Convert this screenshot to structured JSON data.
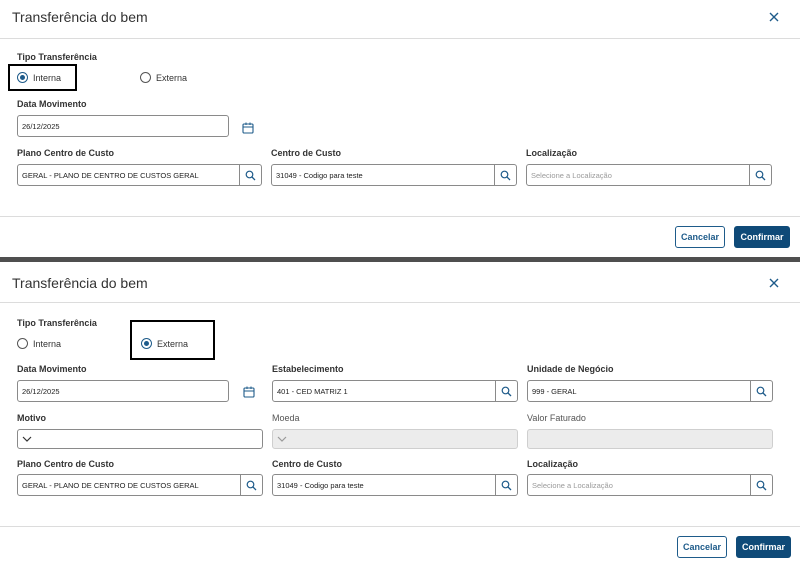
{
  "panel1": {
    "title": "Transferência do bem",
    "tipo_label": "Tipo Transferência",
    "radio_interna": "Interna",
    "radio_externa": "Externa",
    "data_movimento_label": "Data Movimento",
    "data_movimento_value": "26/12/2025",
    "plano_label": "Plano Centro de Custo",
    "plano_value": "GERAL - PLANO DE CENTRO DE CUSTOS GERAL",
    "centro_label": "Centro de Custo",
    "centro_value": "31049 - Codigo para teste",
    "localizacao_label": "Localização",
    "localizacao_placeholder": "Selecione a Localização",
    "cancel": "Cancelar",
    "confirm": "Confirmar",
    "selected": "Interna"
  },
  "panel2": {
    "title": "Transferência do bem",
    "tipo_label": "Tipo Transferência",
    "radio_interna": "Interna",
    "radio_externa": "Externa",
    "data_movimento_label": "Data Movimento",
    "data_movimento_value": "26/12/2025",
    "estabelecimento_label": "Estabelecimento",
    "estabelecimento_value": "401 - CED MATRIZ 1",
    "unidade_label": "Unidade de Negócio",
    "unidade_value": "999 - GERAL",
    "motivo_label": "Motivo",
    "moeda_label": "Moeda",
    "valor_label": "Valor Faturado",
    "plano_label": "Plano Centro de Custo",
    "plano_value": "GERAL - PLANO DE CENTRO DE CUSTOS GERAL",
    "centro_label": "Centro de Custo",
    "centro_value": "31049 - Codigo para teste",
    "localizacao_label": "Localização",
    "localizacao_placeholder": "Selecione a Localização",
    "cancel": "Cancelar",
    "confirm": "Confirmar",
    "selected": "Externa"
  },
  "colors": {
    "accent": "#0f4a78",
    "link": "#1e5b8a",
    "highlight": "#000000"
  },
  "icons": [
    "close-icon",
    "calendar-icon",
    "search-icon",
    "chevron-down-icon"
  ]
}
